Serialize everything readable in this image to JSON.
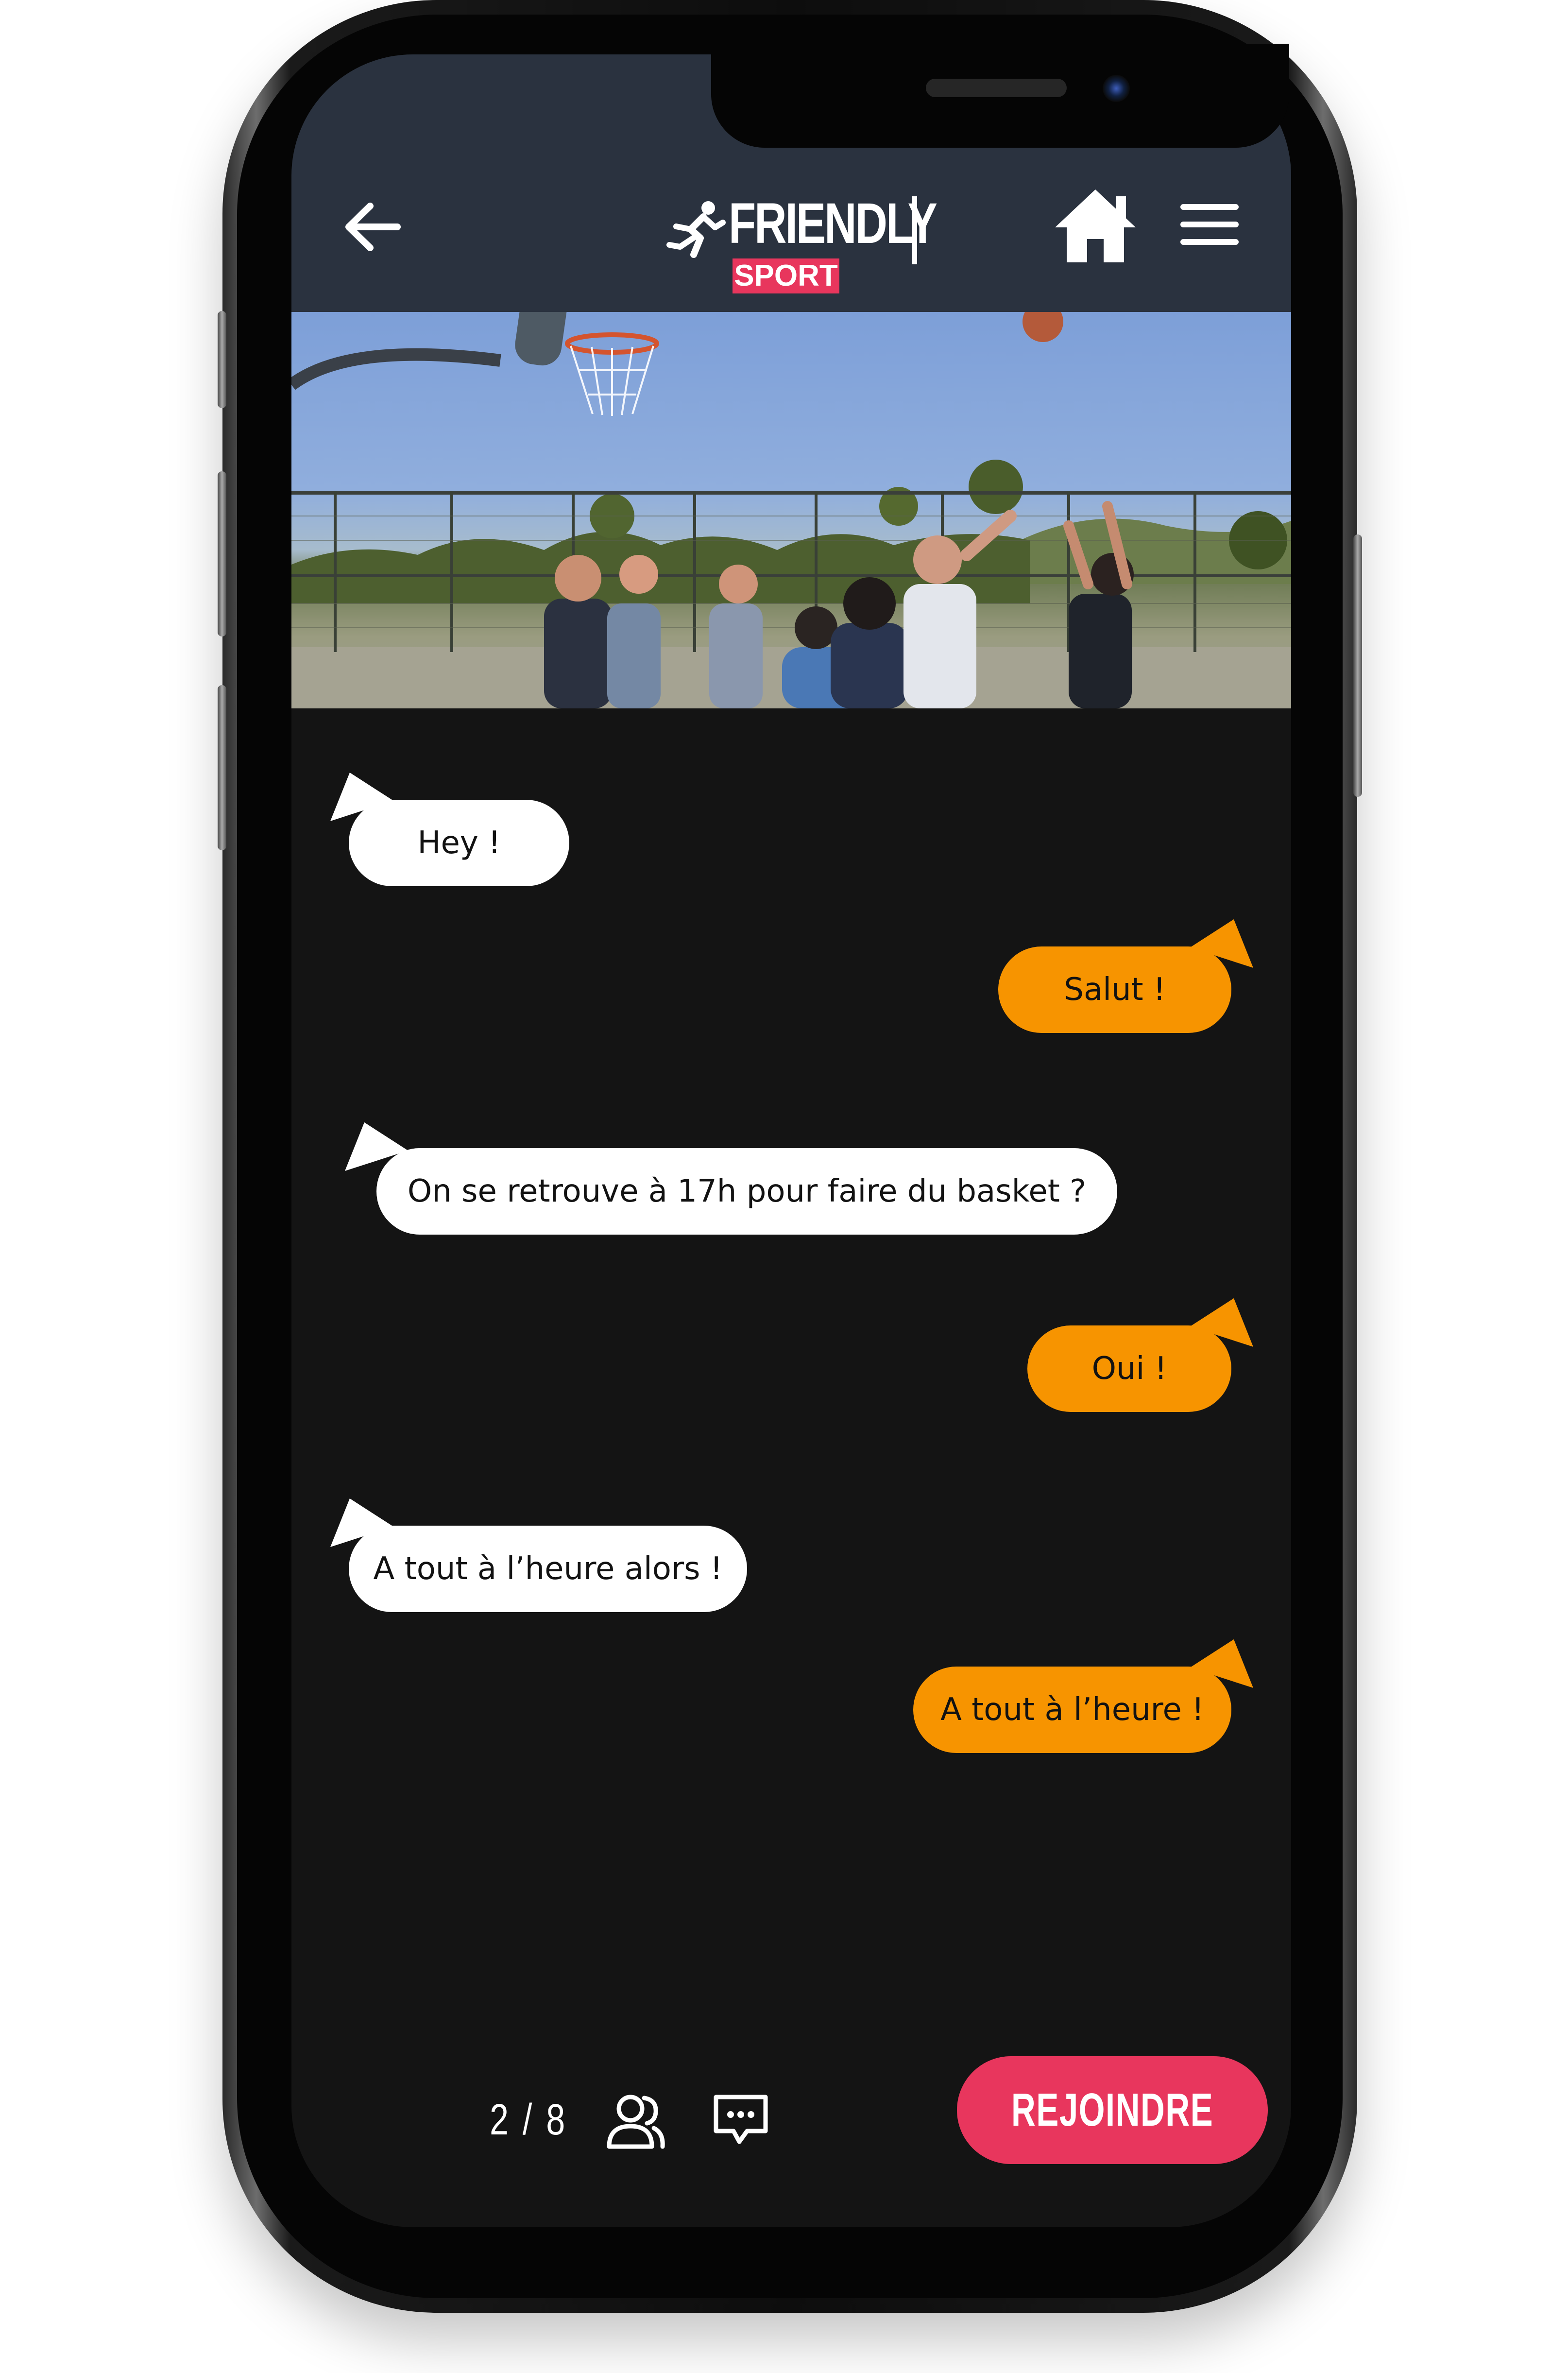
{
  "app": {
    "brand_name": "FRIENDLY",
    "brand_sub": "SPORT"
  },
  "header": {
    "back_icon": "arrow-left-icon",
    "home_icon": "home-icon",
    "menu_icon": "hamburger-menu-icon",
    "background": "#2a323f"
  },
  "hero": {
    "image": "outdoor basketball court photo"
  },
  "messages": [
    {
      "side": "in",
      "text": "Hey !"
    },
    {
      "side": "out",
      "text": "Salut !"
    },
    {
      "side": "in",
      "text": "On se retrouve à 17h pour faire du basket ?"
    },
    {
      "side": "out",
      "text": "Oui !"
    },
    {
      "side": "in",
      "text": "A tout à l’heure alors !"
    },
    {
      "side": "out",
      "text": "A tout à l’heure !"
    }
  ],
  "footer": {
    "participants_count": "2 / 8",
    "participants_icon": "people-icon",
    "chat_icon": "chat-bubble-icon",
    "join_label": "REJOINDRE"
  },
  "colors": {
    "accent_pink": "#e8365d",
    "bubble_orange": "#f79400",
    "bubble_white": "#ffffff",
    "screen_bg": "#141414"
  }
}
